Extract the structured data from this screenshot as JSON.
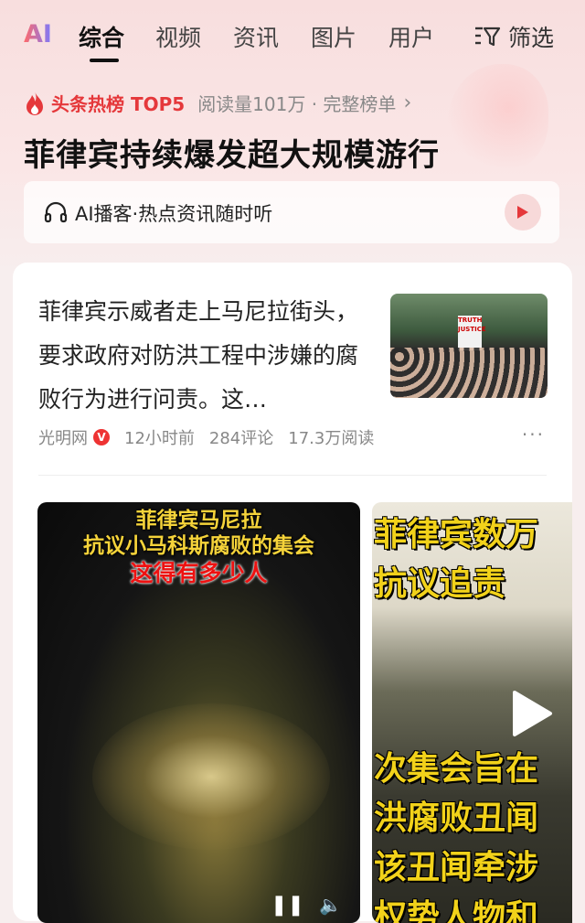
{
  "tabs": {
    "ai": "AI",
    "items": [
      "综合",
      "视频",
      "资讯",
      "图片",
      "用户"
    ],
    "active_index": 0,
    "filter_label": "筛选"
  },
  "hot": {
    "label": "头条热榜 TOP5",
    "meta": "阅读量101万 · 完整榜单",
    "headline": "菲律宾持续爆发超大规模游行"
  },
  "podcast": {
    "text": "AI播客·热点资讯随时听"
  },
  "article": {
    "text": "菲律宾示威者走上马尼拉街头，要求政府对防洪工程中涉嫌的腐败行为进行问责。这…",
    "source": "光明网",
    "badge": "V",
    "time": "12小时前",
    "comments": "284评论",
    "reads": "17.3万阅读",
    "thumb_sign": "TRUTH JUSTICE"
  },
  "videos": [
    {
      "captions": [
        "菲律宾马尼拉",
        "抗议小马科斯腐败的集会",
        "这得有多少人"
      ]
    },
    {
      "captions": [
        "菲律宾数万",
        "抗议追责",
        "次集会旨在",
        "洪腐败丑闻",
        "该丑闻牵涉",
        "权势人物和"
      ]
    }
  ],
  "colors": {
    "accent": "#e5383b",
    "caption_yellow": "#f5d33a"
  }
}
